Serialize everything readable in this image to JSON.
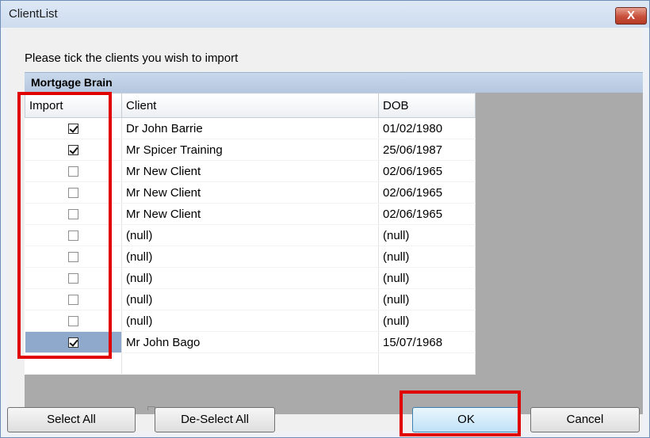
{
  "window": {
    "title": "ClientList",
    "close_label": "X"
  },
  "instruction": "Please tick the clients you wish to import",
  "group": {
    "name": "Mortgage Brain"
  },
  "columns": {
    "import": "Import",
    "client": "Client",
    "dob": "DOB"
  },
  "rows": [
    {
      "checked": true,
      "client": "Dr John Barrie",
      "dob": "01/02/1980"
    },
    {
      "checked": true,
      "client": "Mr Spicer Training",
      "dob": "25/06/1987"
    },
    {
      "checked": false,
      "client": "Mr New Client",
      "dob": "02/06/1965"
    },
    {
      "checked": false,
      "client": "Mr New Client",
      "dob": "02/06/1965"
    },
    {
      "checked": false,
      "client": "Mr New Client",
      "dob": "02/06/1965"
    },
    {
      "checked": false,
      "client": "(null)",
      "dob": "(null)"
    },
    {
      "checked": false,
      "client": "(null)",
      "dob": "(null)"
    },
    {
      "checked": false,
      "client": "(null)",
      "dob": "(null)"
    },
    {
      "checked": false,
      "client": "(null)",
      "dob": "(null)"
    },
    {
      "checked": false,
      "client": "(null)",
      "dob": "(null)"
    },
    {
      "checked": true,
      "client": "Mr John Bago",
      "dob": "15/07/1968",
      "selected": true
    }
  ],
  "buttons": {
    "select_all": "Select All",
    "deselect_all": "De-Select All",
    "ok": "OK",
    "cancel": "Cancel"
  },
  "colors": {
    "highlight": "#e00000",
    "selected_row": "#8fa9cc",
    "group_header": "#b4c7df"
  }
}
